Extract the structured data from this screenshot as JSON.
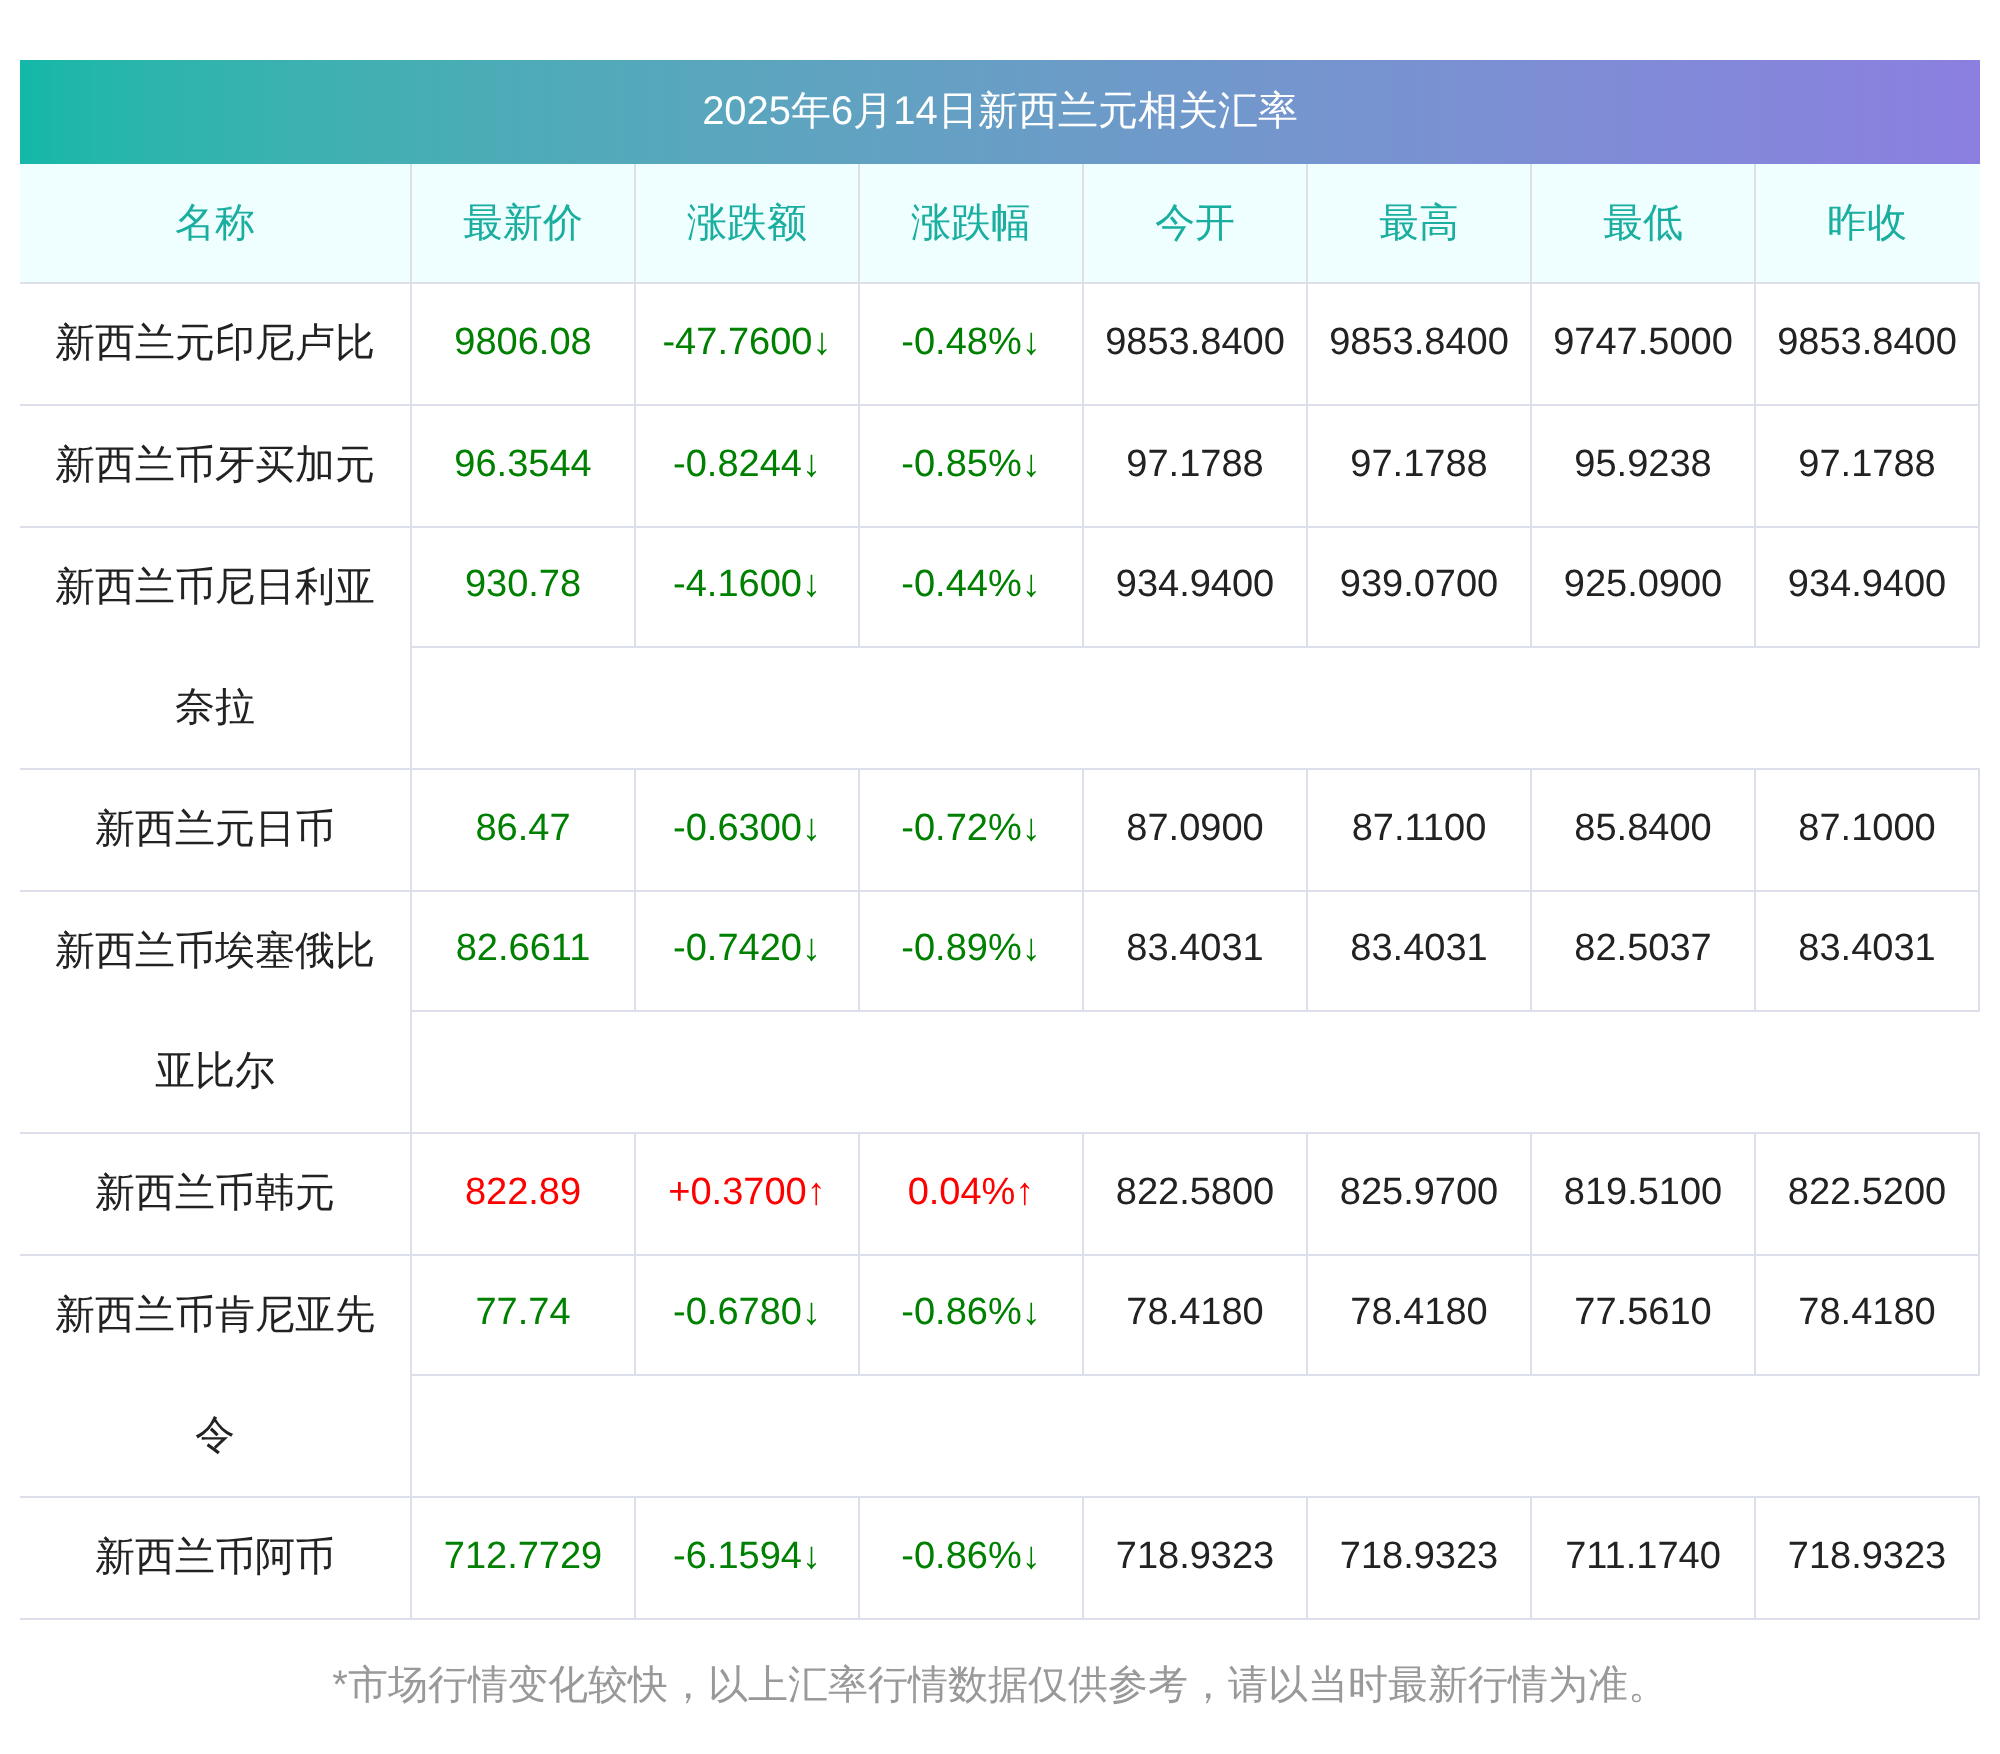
{
  "title": "2025年6月14日新西兰元相关汇率",
  "columns": [
    "名称",
    "最新价",
    "涨跌额",
    "涨跌幅",
    "今开",
    "最高",
    "最低",
    "昨收"
  ],
  "rows": [
    {
      "name": "新西兰元印尼卢比",
      "color": "#008000",
      "cells": [
        "9806.08",
        "-47.7600↓",
        "-0.48%↓",
        "9853.8400",
        "9853.8400",
        "9747.5000",
        "9853.8400"
      ]
    },
    {
      "name": "新西兰币牙买加元",
      "color": "#008000",
      "cells": [
        "96.3544",
        "-0.8244↓",
        "-0.85%↓",
        "97.1788",
        "97.1788",
        "95.9238",
        "97.1788"
      ]
    },
    {
      "name": "新西兰币尼日利亚奈拉",
      "color": "#008000",
      "cells": [
        "930.78",
        "-4.1600↓",
        "-0.44%↓",
        "934.9400",
        "939.0700",
        "925.0900",
        "934.9400"
      ]
    },
    {
      "name": "新西兰元日币",
      "color": "#008000",
      "cells": [
        "86.47",
        "-0.6300↓",
        "-0.72%↓",
        "87.0900",
        "87.1100",
        "85.8400",
        "87.1000"
      ]
    },
    {
      "name": "新西兰币埃塞俄比亚比尔",
      "color": "#008000",
      "cells": [
        "82.6611",
        "-0.7420↓",
        "-0.89%↓",
        "83.4031",
        "83.4031",
        "82.5037",
        "83.4031"
      ]
    },
    {
      "name": "新西兰币韩元",
      "color": "#ff0000",
      "cells": [
        "822.89",
        "+0.3700↑",
        "0.04%↑",
        "822.5800",
        "825.9700",
        "819.5100",
        "822.5200"
      ]
    },
    {
      "name": "新西兰币肯尼亚先令",
      "color": "#008000",
      "cells": [
        "77.74",
        "-0.6780↓",
        "-0.86%↓",
        "78.4180",
        "78.4180",
        "77.5610",
        "78.4180"
      ]
    },
    {
      "name": "新西兰币阿币",
      "color": "#008000",
      "cells": [
        "712.7729",
        "-6.1594↓",
        "-0.86%↓",
        "718.9323",
        "718.9323",
        "711.1740",
        "718.9323"
      ]
    }
  ],
  "note": "*市场行情变化较快，以上汇率行情数据仅供参考，请以当时最新行情为准。"
}
